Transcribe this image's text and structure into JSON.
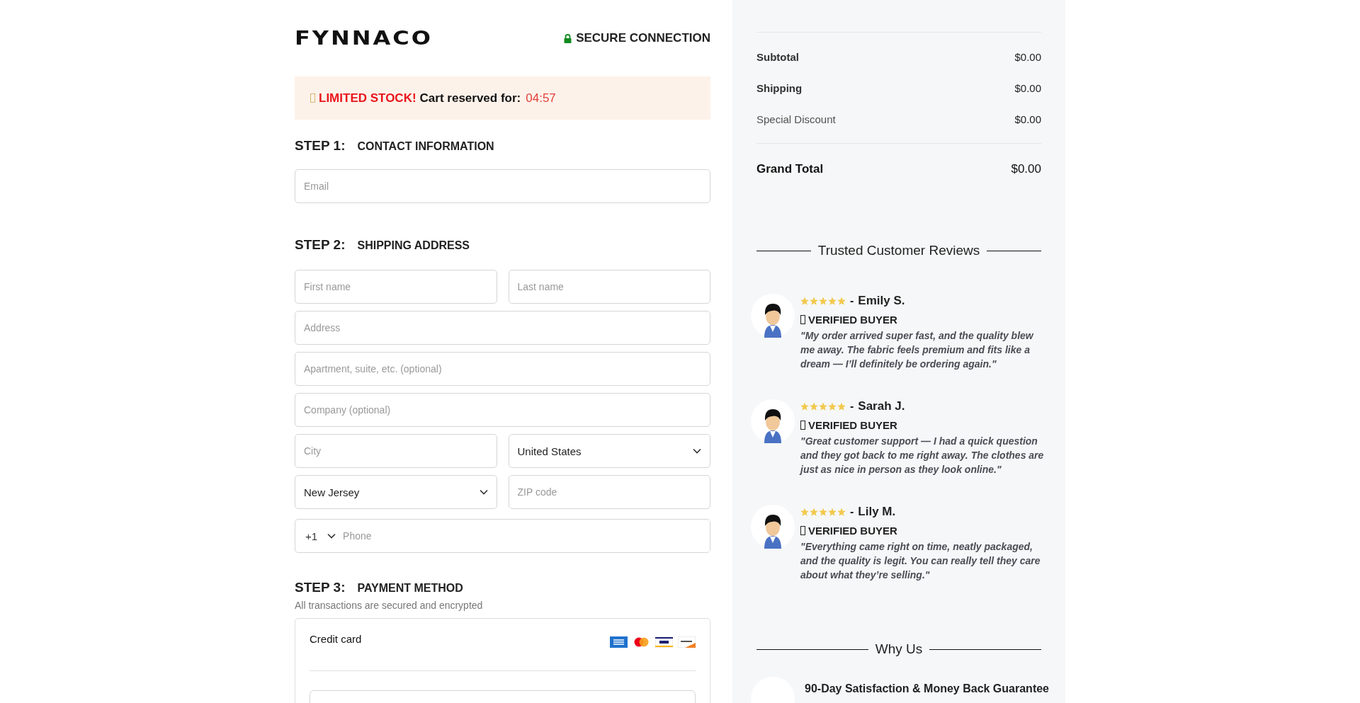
{
  "header": {
    "logo": "FYNNACO",
    "secure": "SECURE CONNECTION"
  },
  "banner": {
    "alert": "LIMITED STOCK!",
    "text": "Cart reserved for:",
    "timer": "04:57"
  },
  "contact": {
    "step": "STEP 1:",
    "title": "CONTACT INFORMATION",
    "rows": [
      [
        {
          "kind": "input",
          "placeholder": "Email"
        }
      ]
    ]
  },
  "shipping": {
    "step": "STEP 2:",
    "title": "SHIPPING ADDRESS",
    "rows": [
      [
        {
          "kind": "input",
          "placeholder": "First name"
        },
        {
          "kind": "input",
          "placeholder": "Last name"
        }
      ],
      [
        {
          "kind": "input",
          "placeholder": "Address"
        }
      ],
      [
        {
          "kind": "input",
          "placeholder": "Apartment, suite, etc. (optional)"
        }
      ],
      [
        {
          "kind": "input",
          "placeholder": "Company (optional)"
        }
      ],
      [
        {
          "kind": "input",
          "placeholder": "City"
        },
        {
          "kind": "select",
          "value": "United States"
        }
      ],
      [
        {
          "kind": "select",
          "value": "New Jersey"
        },
        {
          "kind": "input",
          "placeholder": "ZIP code"
        }
      ],
      [
        {
          "kind": "phone",
          "code": "+1",
          "placeholder": "Phone"
        }
      ]
    ]
  },
  "payment": {
    "step": "STEP 3:",
    "title": "PAYMENT METHOD",
    "note": "All transactions are secured and encrypted",
    "method": "Credit card"
  },
  "summary": {
    "rows": [
      {
        "label": "Subtotal",
        "value": "$0.00",
        "muted": false
      },
      {
        "label": "Shipping",
        "value": "$0.00",
        "muted": false
      },
      {
        "label": "Special Discount",
        "value": "$0.00",
        "muted": true
      }
    ],
    "total": {
      "label": "Grand Total",
      "value": "$0.00"
    }
  },
  "reviews": {
    "heading": "Trusted Customer Reviews",
    "items": [
      {
        "stars": 5,
        "separator": "-",
        "name": "Emily S.",
        "badge": "VERIFIED BUYER",
        "quote": "\"My order arrived super fast, and the quality blew me away. The fabric feels premium and fits like a dream — I’ll definitely be ordering again.\""
      },
      {
        "stars": 5,
        "separator": "-",
        "name": "Sarah J.",
        "badge": "VERIFIED BUYER",
        "quote": "\"Great customer support — I had a quick question and they got back to me right away. The clothes are just as nice in person as they look online.\""
      },
      {
        "stars": 5,
        "separator": "-",
        "name": "Lily M.",
        "badge": "VERIFIED BUYER",
        "quote": "\"Everything came right on time, neatly packaged, and the quality is legit. You can really tell they care about what they’re selling.\""
      }
    ]
  },
  "why_us": {
    "heading": "Why Us",
    "items": [
      {
        "title": "90-Day Satisfaction & Money Back Guarantee"
      }
    ]
  }
}
